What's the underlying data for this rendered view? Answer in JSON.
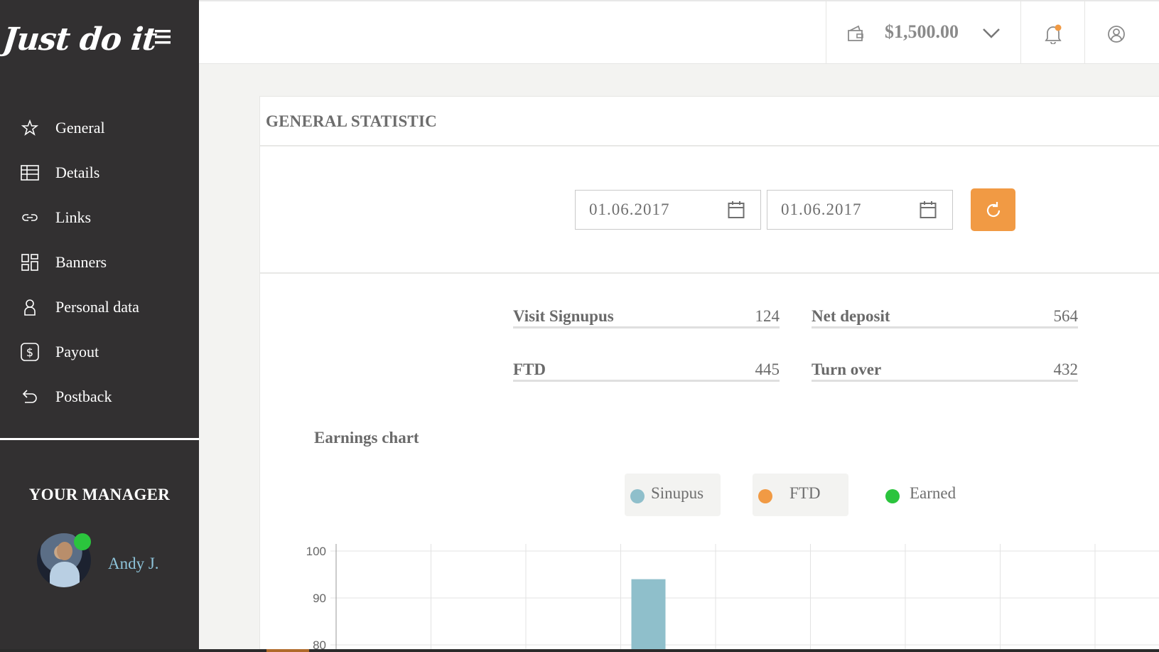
{
  "app": {
    "logo_text": "Just do it"
  },
  "sidebar": {
    "items": [
      {
        "label": "General",
        "icon": "star-icon"
      },
      {
        "label": "Details",
        "icon": "table-icon"
      },
      {
        "label": "Links",
        "icon": "link-icon"
      },
      {
        "label": "Banners",
        "icon": "grid-icon"
      },
      {
        "label": "Personal data",
        "icon": "person-icon"
      },
      {
        "label": "Payout",
        "icon": "dollar-icon"
      },
      {
        "label": "Postback",
        "icon": "return-icon"
      }
    ],
    "manager_title": "YOUR MANAGER",
    "manager_name": "Andy J."
  },
  "topbar": {
    "balance": "$1,500.00"
  },
  "main": {
    "title": "GENERAL STATISTIC",
    "date_from": "01.06.2017",
    "date_to": "01.06.2017",
    "stats": [
      {
        "label": "Visit Signupus",
        "value": "124"
      },
      {
        "label": "Net deposit",
        "value": "564"
      },
      {
        "label": "FTD",
        "value": "445"
      },
      {
        "label": "Turn over",
        "value": "432"
      }
    ],
    "chart_title": "Earnings chart"
  },
  "colors": {
    "accent": "#f19a44",
    "sidebar_bg": "#323031",
    "sinupus": "#8fbfcb",
    "ftd": "#f19a44",
    "earned": "#2bc43d",
    "notification_dot": "#f19a44"
  },
  "chart_data": {
    "type": "bar",
    "series": [
      {
        "name": "Sinupus",
        "color": "#8fbfcb",
        "values": [
          null,
          null,
          null,
          94,
          null,
          null,
          null,
          null,
          null
        ]
      },
      {
        "name": "FTD",
        "color": "#f19a44",
        "values": []
      },
      {
        "name": "Earned",
        "color": "#2bc43d",
        "values": []
      }
    ],
    "y_ticks": [
      "100",
      "90",
      "80"
    ],
    "ylim": [
      80,
      100
    ],
    "grid": true,
    "legend": [
      "Sinupus",
      "FTD",
      "Earned"
    ],
    "legend_position": "top-center"
  }
}
